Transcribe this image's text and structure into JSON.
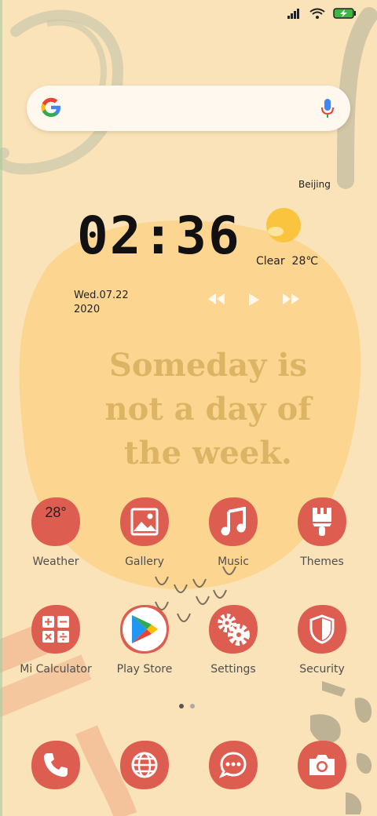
{
  "weather_widget": {
    "city": "Beijing",
    "time": "02:36",
    "condition": "Clear",
    "temperature": "28℃",
    "date_line1": "Wed.07.22",
    "date_line2": "2020"
  },
  "quote": {
    "line1": "Someday is",
    "line2": "not a day of",
    "line3": "the week."
  },
  "apps_row1": [
    {
      "label": "Weather",
      "badge": "28°"
    },
    {
      "label": "Gallery"
    },
    {
      "label": "Music"
    },
    {
      "label": "Themes"
    }
  ],
  "apps_row2": [
    {
      "label": "Mi Calculator"
    },
    {
      "label": "Play Store"
    },
    {
      "label": "Settings"
    },
    {
      "label": "Security"
    }
  ],
  "dock_icons": [
    "phone-icon",
    "browser-icon",
    "messages-icon",
    "camera-icon"
  ],
  "colors": {
    "background": "#fbe3b9",
    "icon_red": "#dd5d51",
    "sun_blob": "#fcd690",
    "quote_text": "#dcb463"
  }
}
